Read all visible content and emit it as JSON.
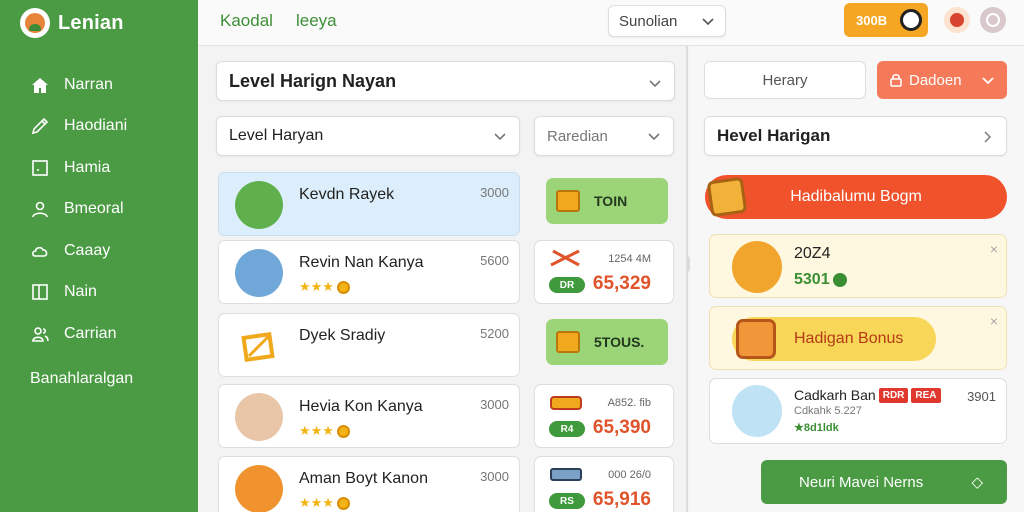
{
  "app": {
    "name": "Lenian",
    "colors": {
      "primary": "#4a9b43",
      "accent": "#f0532c",
      "coin": "#f5a623"
    }
  },
  "sidebar": {
    "items": [
      {
        "label": "Narran",
        "icon": "home-icon"
      },
      {
        "label": "Haodiani",
        "icon": "pencil-icon"
      },
      {
        "label": "Hamia",
        "icon": "square-icon"
      },
      {
        "label": "Bmeoral",
        "icon": "person-icon"
      },
      {
        "label": "Caaay",
        "icon": "cloud-icon"
      },
      {
        "label": "Nain",
        "icon": "panel-icon"
      },
      {
        "label": "Carrian",
        "icon": "user-group-icon"
      }
    ],
    "footer": "Banahlaralgan"
  },
  "topbar": {
    "tabs": [
      "Kaodal",
      "leeya"
    ],
    "select_value": "Sunolian",
    "coin_label": "300B"
  },
  "filters": {
    "main_select": "Level Harign Nayan",
    "level_select": "Level Haryan",
    "sort_select": "Raredian"
  },
  "list": [
    {
      "title": "Kevdn Rayek",
      "num": "3000",
      "selected": true,
      "stars": false
    },
    {
      "title": "Revin Nan Kanya",
      "num": "5600",
      "selected": false,
      "stars": true,
      "star_text": "★★★"
    },
    {
      "title": "Dyek Sradiy",
      "num": "5200",
      "selected": false,
      "stars": false
    },
    {
      "title": "Hevia Kon Kanya",
      "num": "3000",
      "selected": false,
      "stars": true,
      "star_text": "★★★"
    },
    {
      "title": "Aman Boyt Kanon",
      "num": "3000",
      "selected": false,
      "stars": true,
      "star_text": "★★★"
    }
  ],
  "middle": [
    {
      "kind": "pill",
      "label": "TOIN"
    },
    {
      "kind": "price",
      "small": "1254 4M",
      "badge": "DR",
      "price": "65,329"
    },
    {
      "kind": "pill",
      "label": "5TOUS."
    },
    {
      "kind": "price",
      "small": "A852. fib",
      "badge": "R4",
      "price": "65,390"
    },
    {
      "kind": "price",
      "small": "000 26/0",
      "badge": "RS",
      "price": "65,916"
    }
  ],
  "right": {
    "btn_left": "Herary",
    "btn_right": "Dadoen",
    "select": "Hevel Harigan",
    "banner": "Hadibalumu Bogm",
    "card1": {
      "title": "20Z4",
      "value": "5301"
    },
    "bonus": "Hadigan Bonus",
    "list_item": {
      "title": "Cadkarh Ban",
      "tag1": "RDR",
      "tag2": "REA",
      "num": "3901",
      "sub": "Cdkahk 5.227",
      "stars": "★8d1ldk"
    },
    "action": "Neuri Mavei Nerns",
    "close_symbol": "×",
    "more_symbol": "◇"
  }
}
